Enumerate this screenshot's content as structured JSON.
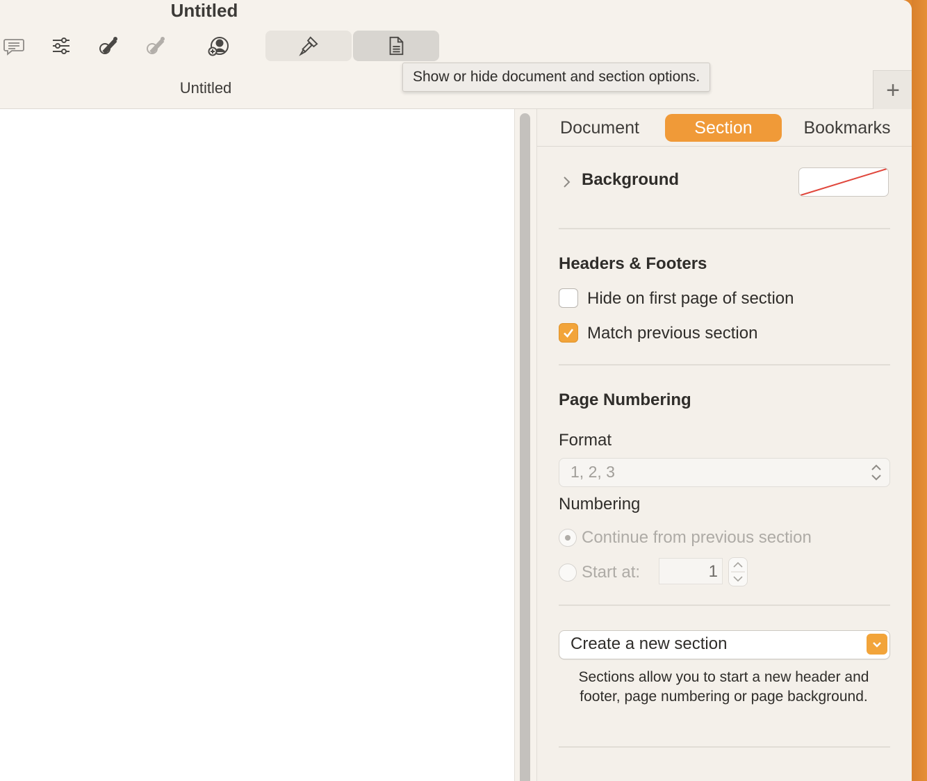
{
  "window": {
    "title": "Untitled",
    "tab_title": "Untitled"
  },
  "toolbar": {
    "icons": [
      "comment-icon",
      "adjust-sliders-icon",
      "pen-icon",
      "pen-disabled-icon",
      "collaborate-icon"
    ],
    "format_button_icon": "paintbrush-icon",
    "document_button_icon": "document-icon",
    "tooltip": "Show or hide document and section options.",
    "new_tab_label": "+"
  },
  "inspector": {
    "tabs": [
      {
        "label": "Document",
        "selected": false
      },
      {
        "label": "Section",
        "selected": true
      },
      {
        "label": "Bookmarks",
        "selected": false
      }
    ],
    "background": {
      "label": "Background",
      "fill": "none"
    },
    "headers_footers": {
      "title": "Headers & Footers",
      "hide_first": {
        "label": "Hide on first page of section",
        "checked": false
      },
      "match_previous": {
        "label": "Match previous section",
        "checked": true
      }
    },
    "page_numbering": {
      "title": "Page Numbering",
      "format_label": "Format",
      "format_value": "1, 2, 3",
      "numbering_label": "Numbering",
      "continue_label": "Continue from previous section",
      "start_label": "Start at:",
      "start_value": "1",
      "selected_option": "continue"
    },
    "create_section": {
      "value": "Create a new section",
      "help": "Sections allow you to start a new header and footer, page numbering or page background."
    }
  },
  "colors": {
    "accent": "#f09a38",
    "checkbox_on": "#f2a43a",
    "desktop": "#e0872e"
  }
}
